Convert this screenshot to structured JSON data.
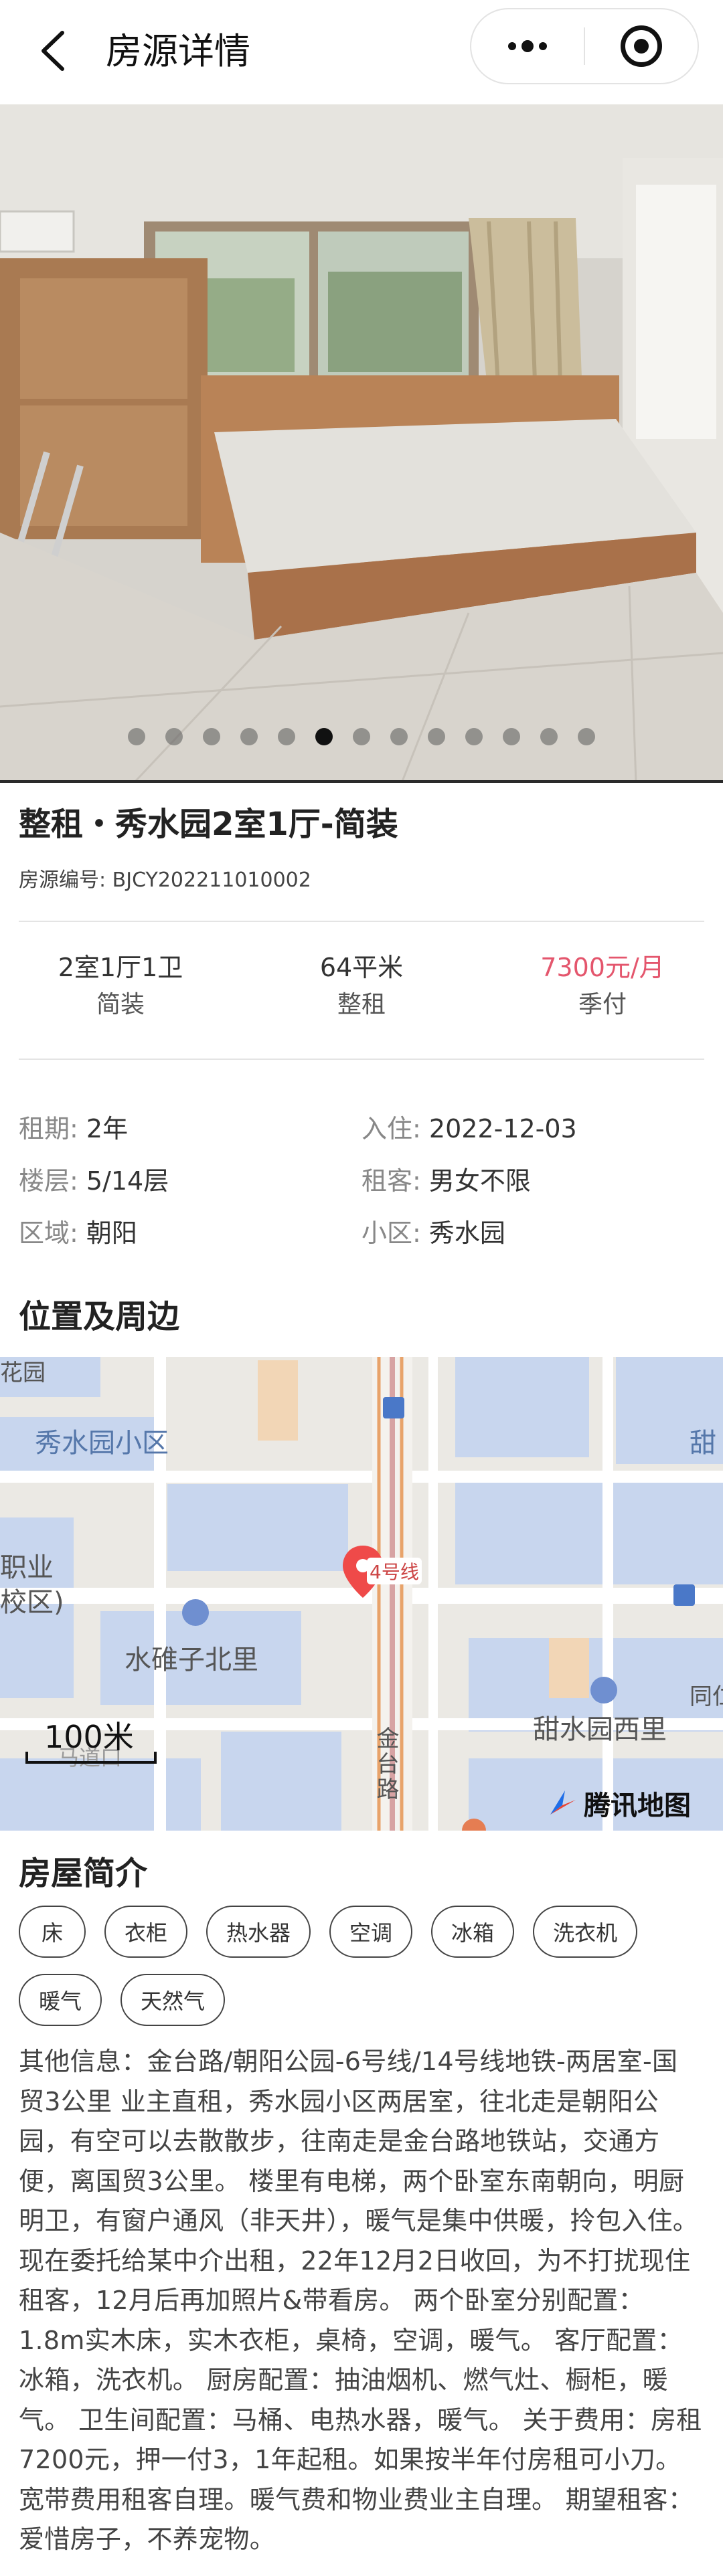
{
  "header": {
    "title": "房源详情",
    "back_icon": "chevron-left-icon",
    "more_icon": "more-dots-icon",
    "close_icon": "target-icon"
  },
  "gallery": {
    "total": 13,
    "active_index": 5
  },
  "listing": {
    "title": "整租・秀水园2室1厅-简装",
    "code": "房源编号: BJCY202211010002"
  },
  "stats": [
    {
      "value": "2室1厅1卫",
      "sub": "简装"
    },
    {
      "value": "64平米",
      "sub": "整租"
    },
    {
      "value": "7300元/月",
      "sub": "季付",
      "color": "#e4566d"
    }
  ],
  "props": [
    [
      {
        "k": "租期: ",
        "v": "2年"
      },
      {
        "k": "入住: ",
        "v": "2022-12-03"
      }
    ],
    [
      {
        "k": "楼层: ",
        "v": "5/14层"
      },
      {
        "k": "租客: ",
        "v": "男女不限"
      }
    ],
    [
      {
        "k": "区域: ",
        "v": "朝阳"
      },
      {
        "k": "小区: ",
        "v": "秀水园"
      }
    ]
  ],
  "location": {
    "section_title": "位置及周边",
    "labels": {
      "l1": "花园",
      "l2": "秀水园小区",
      "l3": "甜",
      "l4": "职业",
      "l5": "校区)",
      "l6": "4号线",
      "l7": "水碓子北里",
      "l8": "甜水园西里",
      "l9": "同仁",
      "l10": "金台路",
      "l11": "马道口"
    },
    "scale": "100米",
    "provider": "腾讯地图"
  },
  "house": {
    "section_title": "房屋简介",
    "amenities": [
      "床",
      "衣柜",
      "热水器",
      "空调",
      "冰箱",
      "洗衣机",
      "暖气",
      "天然气"
    ],
    "description": "其他信息：金台路/朝阳公园-6号线/14号线地铁-两居室-国贸3公里 业主直租，秀水园小区两居室，往北走是朝阳公园，有空可以去散散步，往南走是金台路地铁站，交通方便，离国贸3公里。 楼里有电梯，两个卧室东南朝向，明厨明卫，有窗户通风（非天井），暖气是集中供暖，拎包入住。 现在委托给某中介出租，22年12月2日收回，为不打扰现住租客，12月后再加照片&带看房。 两个卧室分别配置：1.8m实木床，实木衣柜，桌椅，空调，暖气。 客厅配置：冰箱，洗衣机。 厨房配置：抽油烟机、燃气灶、橱柜，暖气。 卫生间配置：马桶、电热水器，暖气。 关于费用：房租7200元，押一付3，1年起租。如果按半年付房租可小刀。 宽带费用租客自理。暖气费和物业费业主自理。 期望租客：爱惜房子，不养宠物。"
  }
}
